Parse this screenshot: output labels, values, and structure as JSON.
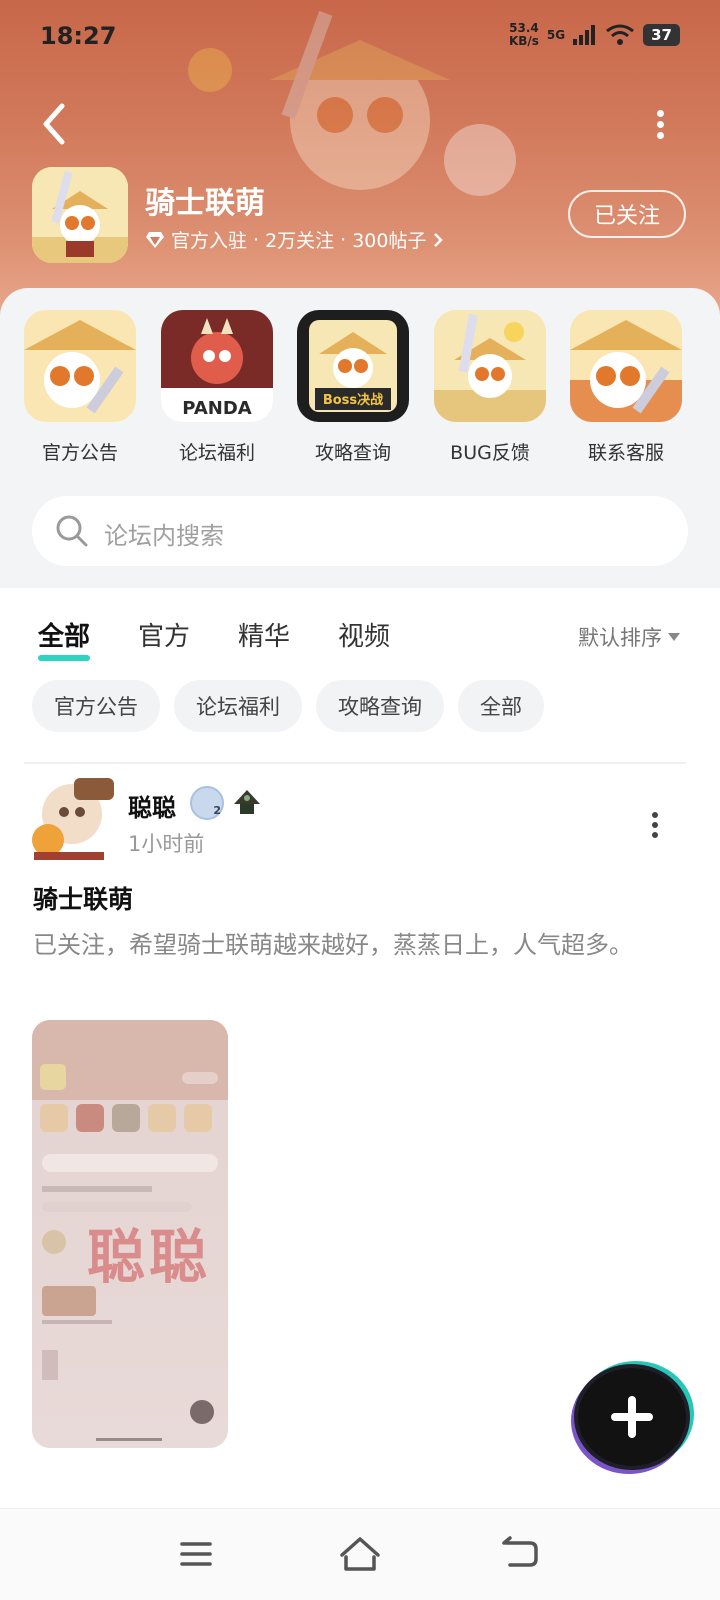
{
  "status_bar": {
    "time": "18:27",
    "net_speed": "53.4",
    "net_unit": "KB/s",
    "network": "5G",
    "battery": "37"
  },
  "forum": {
    "name": "骑士联萌",
    "badge": "官方入驻",
    "followers": "2万关注",
    "posts": "300帖子",
    "follow_label": "已关注"
  },
  "quick_links": [
    {
      "label": "官方公告"
    },
    {
      "label": "论坛福利"
    },
    {
      "label": "攻略查询"
    },
    {
      "label": "BUG反馈"
    },
    {
      "label": "联系客服"
    }
  ],
  "quick_icon_text": {
    "panda": "PANDA",
    "boss": "Boss决战"
  },
  "search": {
    "placeholder": "论坛内搜索"
  },
  "tabs": [
    {
      "label": "全部",
      "active": true
    },
    {
      "label": "官方"
    },
    {
      "label": "精华"
    },
    {
      "label": "视频"
    }
  ],
  "sort_label": "默认排序",
  "chips": [
    "官方公告",
    "论坛福利",
    "攻略查询",
    "全部"
  ],
  "post": {
    "author": "聪聪",
    "level": "2",
    "time": "1小时前",
    "title": "骑士联萌",
    "body": "已关注，希望骑士联萌越来越好，蒸蒸日上，人气超多。",
    "watermark": "聪聪"
  },
  "colors": {
    "accent": "#2ed3c2",
    "header_bg": "#d27a5c",
    "watermark": "#d26464"
  }
}
